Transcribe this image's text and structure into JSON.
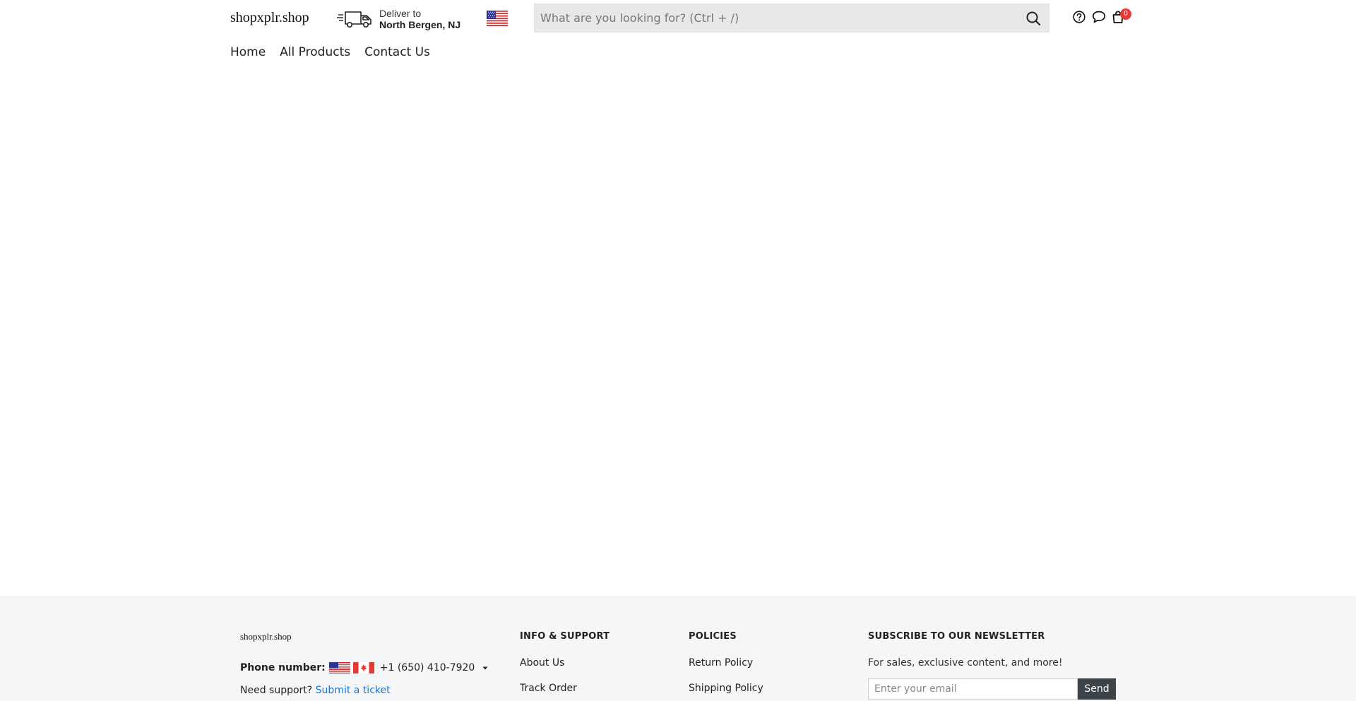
{
  "header": {
    "logo": "shopxplr.shop",
    "deliver_label": "Deliver to",
    "deliver_city": "North Bergen, NJ",
    "country_flag": "us-flag-icon",
    "search_placeholder": "What are you looking for? (Ctrl + /)",
    "icons": [
      "help-icon",
      "chat-icon",
      "cart-icon"
    ],
    "cart_count": "0",
    "badge_color": "#e53935"
  },
  "nav": {
    "items": [
      "Home",
      "All Products",
      "Contact Us"
    ]
  },
  "footer": {
    "logo": "shopxplr.shop",
    "phone_label": "Phone number:",
    "phone_flags": [
      "us-flag-icon",
      "canada-flag-icon"
    ],
    "phone_number": "+1 (650) 410-7920",
    "support_text": "Need support?",
    "support_link": "Submit a ticket",
    "support_link_color": "#1976d2",
    "columns": [
      {
        "heading": "INFO & SUPPORT",
        "links": [
          "About Us",
          "Track Order"
        ]
      },
      {
        "heading": "POLICIES",
        "links": [
          "Return Policy",
          "Shipping Policy"
        ]
      }
    ],
    "newsletter": {
      "heading": "SUBSCRIBE TO OUR NEWSLETTER",
      "text": "For sales, exclusive content, and more!",
      "placeholder": "Enter your email",
      "button": "Send"
    }
  }
}
